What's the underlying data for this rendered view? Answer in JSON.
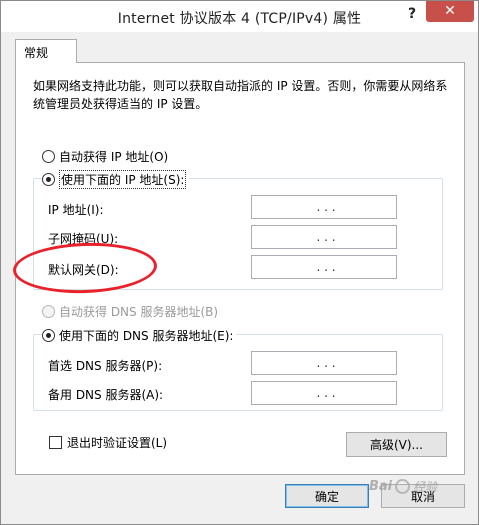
{
  "window": {
    "title": "Internet 协议版本 4 (TCP/IPv4) 属性",
    "help_label": "?",
    "close_label": "✕"
  },
  "tabs": [
    {
      "label": "常规"
    }
  ],
  "general": {
    "description": "如果网络支持此功能，则可以获取自动指派的 IP 设置。否则，你需要从网络系统管理员处获得适当的 IP 设置。",
    "ip_mode": {
      "auto_label": "自动获得 IP 地址(O)",
      "manual_label": "使用下面的 IP 地址(S):",
      "selected": "manual"
    },
    "ip_fields": [
      {
        "label": "IP 地址(I):",
        "value": ". . ."
      },
      {
        "label": "子网掩码(U):",
        "value": ". . ."
      },
      {
        "label": "默认网关(D):",
        "value": ". . ."
      }
    ],
    "dns_mode": {
      "auto_label": "自动获得 DNS 服务器地址(B)",
      "manual_label": "使用下面的 DNS 服务器地址(E):",
      "selected": "manual"
    },
    "dns_fields": [
      {
        "label": "首选 DNS 服务器(P):",
        "value": ". . ."
      },
      {
        "label": "备用 DNS 服务器(A):",
        "value": ". . ."
      }
    ],
    "validate_on_exit_label": "退出时验证设置(L)",
    "validate_on_exit_checked": false,
    "advanced_button": "高级(V)..."
  },
  "footer": {
    "ok_button": "确定",
    "cancel_button": "取消"
  },
  "watermark": {
    "text_a": "Bai",
    "text_b": "经验"
  },
  "colors": {
    "close_button": "#c7504a",
    "annotation_ring": "#e8212b",
    "default_button_border": "#3c7fb1"
  }
}
